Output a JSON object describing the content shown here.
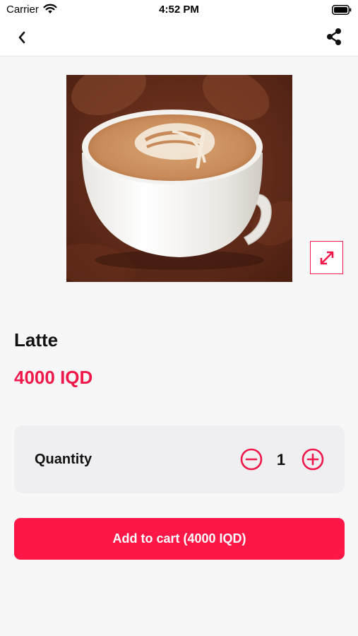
{
  "status_bar": {
    "carrier": "Carrier",
    "time": "4:52 PM",
    "icons": [
      "wifi-icon",
      "battery-icon"
    ]
  },
  "nav": {
    "back_icon": "chevron-left-icon",
    "share_icon": "share-icon"
  },
  "product": {
    "image": "latte-art-cup-photo",
    "expand_icon": "expand-icon",
    "name": "Latte",
    "price": "4000 IQD"
  },
  "quantity": {
    "label": "Quantity",
    "value": "1",
    "minus_icon": "minus-circle-icon",
    "plus_icon": "plus-circle-icon"
  },
  "cart": {
    "add_label": "Add to cart (4000 IQD)"
  },
  "colors": {
    "accent": "#f0174a",
    "button": "#fe1746",
    "background": "#f7f7f8",
    "card": "#efeff2"
  }
}
